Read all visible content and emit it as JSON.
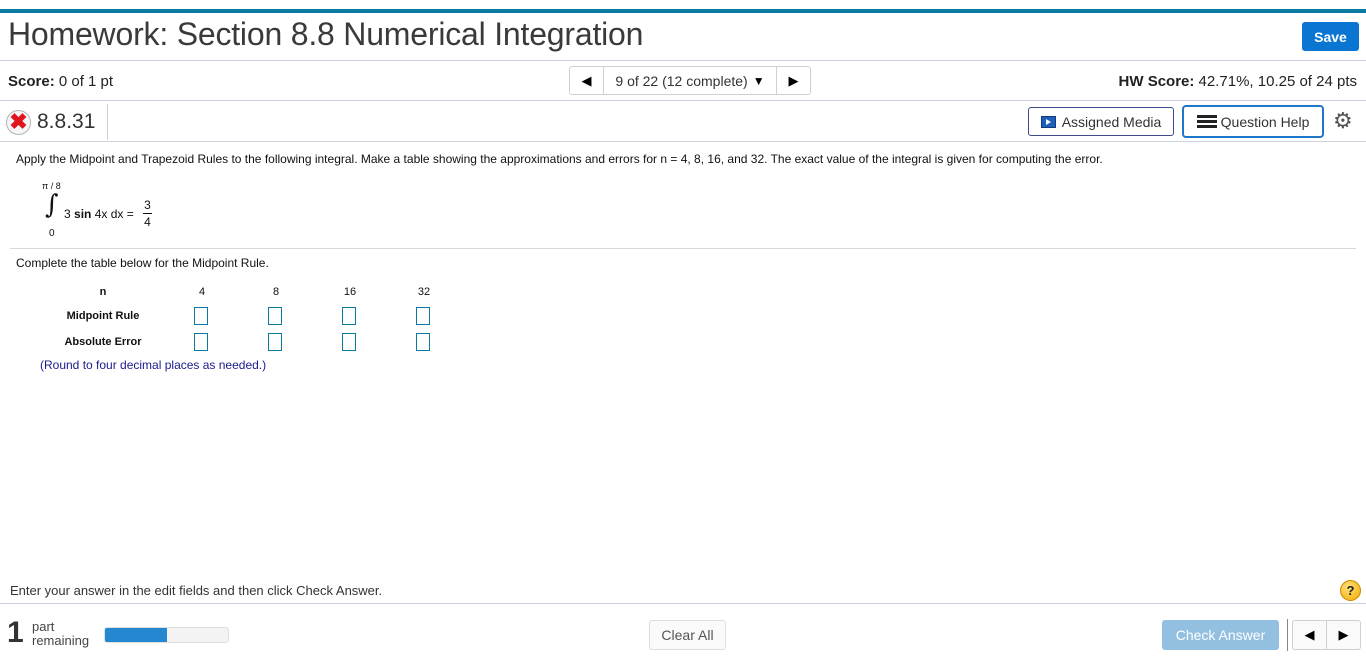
{
  "header": {
    "title": "Homework: Section 8.8 Numerical Integration",
    "save_label": "Save",
    "accent_color": "#0a7ba3"
  },
  "scorebar": {
    "score_label": "Score:",
    "score_value": "0 of 1 pt",
    "nav_position": "9 of 22 (12 complete)",
    "nav_prev_icon": "◀",
    "nav_next_icon": "▶",
    "nav_caret_icon": "▼",
    "hw_score_label": "HW Score:",
    "hw_score_value": "42.71%, 10.25 of 24 pts"
  },
  "question_bar": {
    "status_icon": "incorrect-x-icon",
    "status_glyph": "✖",
    "question_id": "8.8.31",
    "assigned_media_label": "Assigned Media",
    "question_help_label": "Question Help",
    "settings_glyph": "⚙"
  },
  "question": {
    "prompt": "Apply the Midpoint and Trapezoid Rules to the following integral. Make a table showing the approximations and errors for n = 4, 8, 16, and 32. The exact value of the integral is given for computing the error.",
    "integral": {
      "upper_limit": "π / 8",
      "lower_limit": "0",
      "sign": "∫",
      "coef": "3",
      "func": "sin",
      "arg": "4x dx =",
      "result_numerator": "3",
      "result_denominator": "4"
    },
    "subprompt": "Complete the table below for the Midpoint Rule.",
    "table": {
      "header_label": "n",
      "n_values": [
        "4",
        "8",
        "16",
        "32"
      ],
      "rows": [
        {
          "label": "Midpoint Rule",
          "values": [
            "",
            "",
            "",
            ""
          ]
        },
        {
          "label": "Absolute Error",
          "values": [
            "",
            "",
            "",
            ""
          ]
        }
      ]
    },
    "round_note": "(Round to four decimal places as needed.)"
  },
  "footer": {
    "instruction": "Enter your answer in the edit fields and then click Check Answer.",
    "help_glyph": "?",
    "parts_count": "1",
    "parts_word1": "part",
    "parts_word2": "remaining",
    "progress_fraction": 0.5,
    "clear_all_label": "Clear All",
    "check_answer_label": "Check Answer",
    "prev_icon": "◀",
    "next_icon": "▶"
  }
}
